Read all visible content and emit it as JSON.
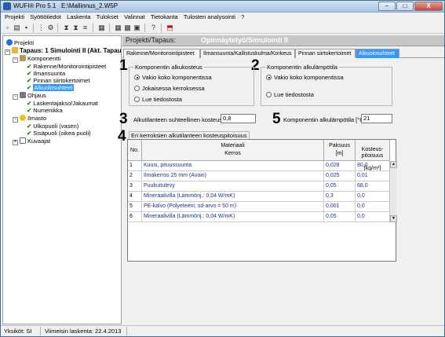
{
  "window": {
    "app": "WUFI® Pro 5.1",
    "file": "E:\\Mallinnus_2.W5P",
    "minimize": "–",
    "maximize": "□",
    "close": "X"
  },
  "menu": [
    "Projekti",
    "Syöttötiedot",
    "Laskenta",
    "Tulokset",
    "Valinnat",
    "Tietokanta",
    "Tulosten analysointi",
    "?"
  ],
  "tree": {
    "root": "Projekti",
    "case": "Tapaus: 1 Simulointi II (Akt. Tapaus)",
    "komponentti": "Komponentti",
    "rakenne": "Rakenne/Monitorointipisteet",
    "ilmansuunta": "Ilmansuunta",
    "pinnan": "Pinnan siirtokertoimet",
    "alkuolosuhteet": "Alkuolosuhteet",
    "ohjaus": "Ohjaus",
    "laskentajakso": "Laskentajakso/Jakaumat",
    "numeriikka": "Numeriikka",
    "ilmasto": "Ilmasto",
    "ulkopuoli": "Ulkopuoli (vasen)",
    "sisapuoli": "Sisäpuoli (oikea puoli)",
    "kuvaajat": "Kuvaajat"
  },
  "header": {
    "label": "Projekti/Tapaus:",
    "value": "Opinnäytetyö/Simulointi II"
  },
  "tabs": [
    "Rakenne/Monitorointipisteet",
    "Ilmansuunta/Kallistuskulma/Korkeus",
    "Pinnan siirtokertoimet",
    "Alkuolosuhteet"
  ],
  "numbers": [
    "1",
    "2",
    "3",
    "4",
    "5"
  ],
  "moisture_group": {
    "title": "Komponentin alkukosteus",
    "options": [
      "Vakio koko komponentissa",
      "Jokaisessa kerroksessa",
      "Lue tiedostosta"
    ],
    "selected": 0
  },
  "temp_group": {
    "title": "Komponentin alkulämpötila",
    "options": [
      "Vakio koko komponentissa",
      "Lue tiedostosta"
    ],
    "selected": 0
  },
  "rh_field": {
    "label": "Alkutilanteen suhteellinen kosteus [-]",
    "value": "0,8"
  },
  "temp_field": {
    "label": "Komponentin alkulämpötila [°C]",
    "value": "21"
  },
  "layers": {
    "title": "Eri kerroksien alkutilanteen kosteuspitoisuus",
    "headers": {
      "no": "No.",
      "material": "Materiaali",
      "layer": "Kerros",
      "thickness": "Paksuus",
      "thickness_unit": "[m]",
      "moisture": "Kosteus-\npitoisuus",
      "moisture_unit": "[kg/m³]"
    },
    "rows": [
      {
        "no": "1",
        "name": "Kuusi, pituussuunta",
        "thickness": "0,028",
        "moisture": "80,0"
      },
      {
        "no": "2",
        "name": "Ilmakerros 25 mm (Avoin)",
        "thickness": "0,025",
        "moisture": "0,01"
      },
      {
        "no": "3",
        "name": "Puukuitulevy",
        "thickness": "0,05",
        "moisture": "68,0"
      },
      {
        "no": "4",
        "name": "Mineraalivilla (Lämmönj.: 0,04 W/mK)",
        "thickness": "0,3",
        "moisture": "0,0"
      },
      {
        "no": "5",
        "name": "PE-kalvo (Polyeteeni; sd-arvo = 50 m)",
        "thickness": "0,001",
        "moisture": "0,0"
      },
      {
        "no": "6",
        "name": "Mineraalivilla (Lämmönj.: 0,04 W/mK)",
        "thickness": "0,05",
        "moisture": "0,0"
      }
    ]
  },
  "status": {
    "units": "Yksiköt: SI",
    "last_calc": "Viimeisin laskenta: 22.4.2013"
  },
  "colors": {
    "selected": "#3399ff",
    "accent_tick": "#1a8a1a",
    "link_text": "#1f2f8f"
  }
}
